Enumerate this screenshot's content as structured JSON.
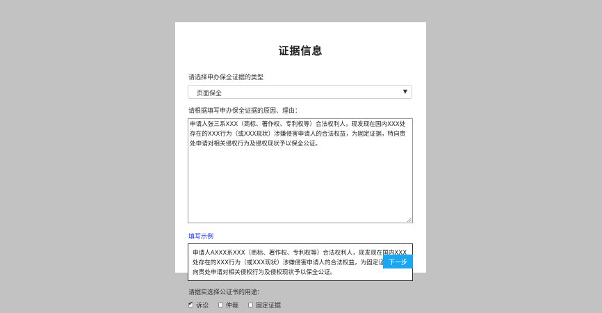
{
  "form": {
    "title": "证据信息",
    "type_label": "请选择申办保全证据的类型",
    "type_selected": "页面保全",
    "reason_label": "请根据填写申办保全证据的原因、理由：",
    "reason_text": "申请人张三系XXX（商标、著作权、专利权等）合法权利人，现发现在国内XXX处存在的XXX行为（或XXX现状）涉嫌侵害申请人的合法权益，为固定证据，特向贵处申请对相关侵权行为及侵权现状予以保全公证。",
    "example_link": "填写示例",
    "example_text": "申请人AXXX系XXX（商标、著作权、专利权等）合法权利人，现发现在国内XXX处存在的XXX行为（或XXX现状）涉嫌侵害申请人的合法权益，为固定证据，特向贵处申请对相关侵权行为及侵权现状予以保全公证。",
    "next_button": "下一步",
    "usage_label": "请据实选择公证书的用途：",
    "usage_options": [
      {
        "label": "诉讼",
        "checked": true
      },
      {
        "label": "仲裁",
        "checked": false
      },
      {
        "label": "固定证据",
        "checked": false
      }
    ]
  },
  "colors": {
    "background": "#c2c2c2",
    "card": "#ffffff",
    "link": "#1a2fd8",
    "button": "#1aa7f0"
  }
}
